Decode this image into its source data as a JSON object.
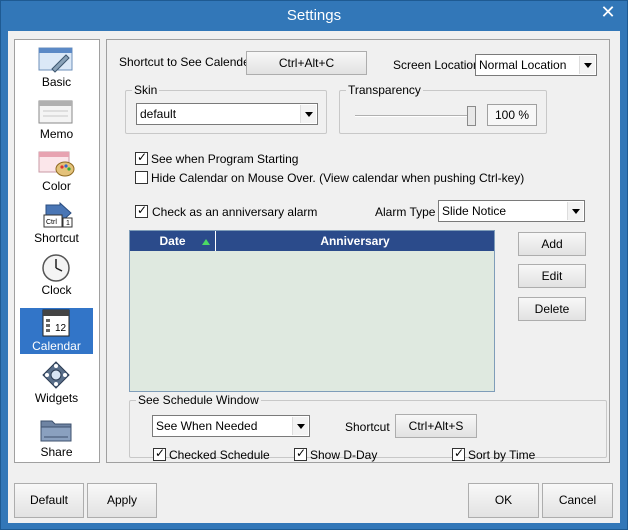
{
  "window": {
    "title": "Settings",
    "close": "✕"
  },
  "sidebar": {
    "items": [
      {
        "label": "Basic",
        "icon": "basic-icon"
      },
      {
        "label": "Memo",
        "icon": "memo-icon"
      },
      {
        "label": "Color",
        "icon": "color-icon"
      },
      {
        "label": "Shortcut",
        "icon": "shortcut-icon"
      },
      {
        "label": "Clock",
        "icon": "clock-icon"
      },
      {
        "label": "Calendar",
        "icon": "calendar-icon"
      },
      {
        "label": "Widgets",
        "icon": "widgets-icon"
      },
      {
        "label": "Share",
        "icon": "share-icon"
      }
    ],
    "active_index": 5,
    "calendar_icon_text": "12",
    "shortcut_icon_text": "Ctrl 1"
  },
  "panel": {
    "shortcut_label": "Shortcut to See Calender",
    "shortcut_value": "Ctrl+Alt+C",
    "screen_location_label": "Screen Location",
    "screen_location_value": "Normal Location",
    "skin_label": "Skin",
    "skin_value": "default",
    "transparency_label": "Transparency",
    "transparency_value": "100 %",
    "transparency_level": 1.0,
    "see_when_starting": {
      "label": "See when Program Starting",
      "checked": true
    },
    "hide_on_mouse_over": {
      "label": "Hide Calendar on Mouse Over. (View calendar when pushing Ctrl-key)",
      "checked": false
    },
    "anniversary_alarm": {
      "label": "Check as an anniversary alarm",
      "checked": true
    },
    "alarm_type_label": "Alarm Type",
    "alarm_type_value": "Slide Notice",
    "table": {
      "columns": [
        "Date",
        "Anniversary"
      ],
      "rows": []
    },
    "buttons": {
      "add": "Add",
      "edit": "Edit",
      "delete": "Delete"
    },
    "schedule": {
      "group_label": "See Schedule Window",
      "mode_value": "See When Needed",
      "shortcut_label": "Shortcut",
      "shortcut_value": "Ctrl+Alt+S",
      "checked_schedule": {
        "label": "Checked Schedule",
        "checked": true
      },
      "show_dday": {
        "label": "Show D-Day",
        "checked": true
      },
      "sort_by_time": {
        "label": "Sort by Time",
        "checked": true
      }
    }
  },
  "footer": {
    "default": "Default",
    "apply": "Apply",
    "ok": "OK",
    "cancel": "Cancel"
  },
  "colors": {
    "titlebar": "#3277b8",
    "active_item": "#3275c8",
    "grid_header": "#2b4b8b",
    "grid_body": "#dfe9e0"
  }
}
